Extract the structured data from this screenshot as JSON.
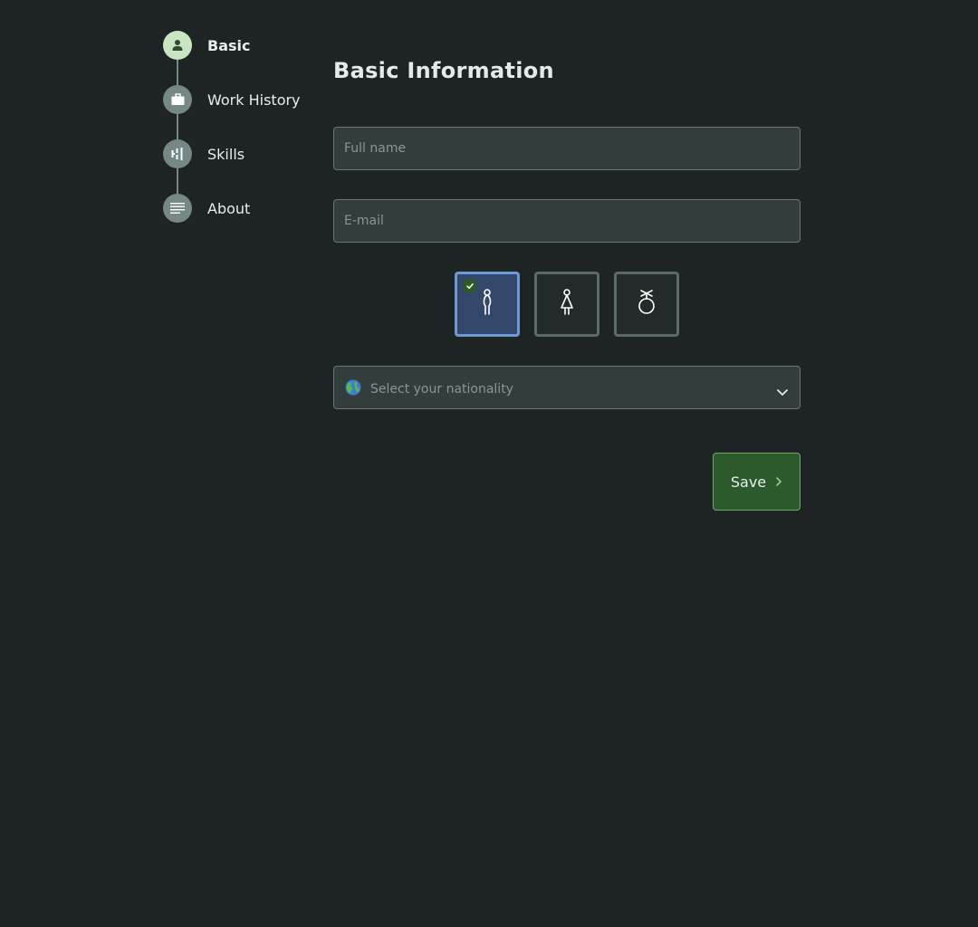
{
  "stepper": {
    "steps": [
      {
        "label": "Basic",
        "icon": "person-icon",
        "active": true
      },
      {
        "label": "Work History",
        "icon": "briefcase-icon",
        "active": false
      },
      {
        "label": "Skills",
        "icon": "sliders-icon",
        "active": false
      },
      {
        "label": "About",
        "icon": "lines-icon",
        "active": false
      }
    ]
  },
  "form": {
    "title": "Basic Information",
    "full_name": {
      "value": "",
      "placeholder": "Full name"
    },
    "email": {
      "value": "",
      "placeholder": "E-mail"
    },
    "gender_options": [
      {
        "icon": "male-icon",
        "selected": true
      },
      {
        "icon": "female-icon",
        "selected": false
      },
      {
        "icon": "other-gender-icon",
        "selected": false
      }
    ],
    "nationality": {
      "icon": "globe-icon",
      "placeholder": "Select your nationality"
    },
    "save_label": "Save"
  },
  "colors": {
    "background": "#1e2424",
    "active_step": "#c8e6c4",
    "inactive_step": "#758787",
    "selected_tile": "#33476a",
    "selected_border": "#6b9bd2",
    "save_button": "#2c5a2c",
    "save_border": "#6da86a"
  }
}
